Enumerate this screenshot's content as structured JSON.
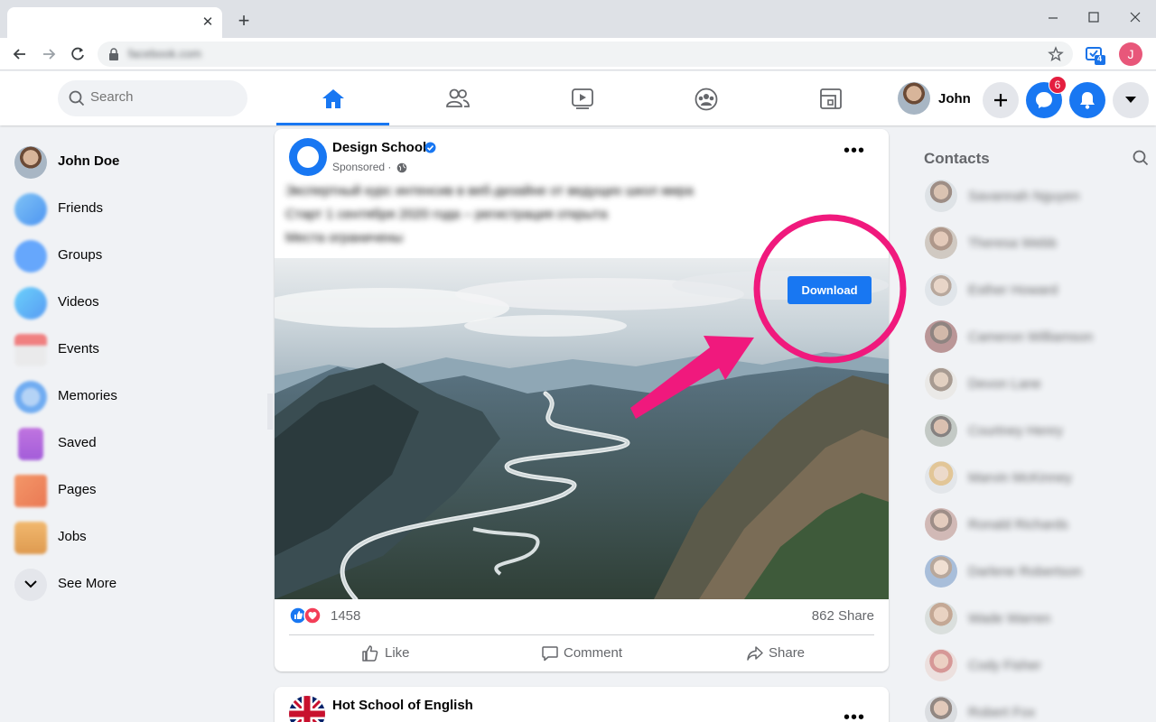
{
  "browser": {
    "close_tab_glyph": "✕",
    "new_tab_glyph": "+",
    "url": "facebook.com",
    "extension_badge": "4",
    "profile_initial": "J"
  },
  "header": {
    "search_placeholder": "Search",
    "user_name": "John",
    "messenger_badge": "6",
    "brand_color": "#1877f2"
  },
  "left_nav": {
    "items": [
      {
        "label": "John Doe",
        "icon": "avatar"
      },
      {
        "label": "Friends",
        "icon": "friends-icon"
      },
      {
        "label": "Groups",
        "icon": "groups-icon"
      },
      {
        "label": "Videos",
        "icon": "videos-icon"
      },
      {
        "label": "Events",
        "icon": "events-icon"
      },
      {
        "label": "Memories",
        "icon": "memories-icon"
      },
      {
        "label": "Saved",
        "icon": "saved-icon"
      },
      {
        "label": "Pages",
        "icon": "pages-icon"
      },
      {
        "label": "Jobs",
        "icon": "jobs-icon"
      },
      {
        "label": "See More",
        "icon": "chevron-down-icon"
      }
    ]
  },
  "post": {
    "page_name": "Design School",
    "sponsored": "Sponsored ·",
    "text_lines": [
      "Экспертный курс интенсив в веб-дизайне от ведущих школ мира",
      "Старт 1 сентября 2020 года – регистрация открыта",
      "Места ограничены"
    ],
    "download_label": "Download",
    "reactions_count": "1458",
    "shares": "862",
    "shares_label": "Share",
    "actions": {
      "like": "Like",
      "comment": "Comment",
      "share": "Share"
    }
  },
  "post2": {
    "page_name": "Hot School of English"
  },
  "contacts": {
    "title": "Contacts",
    "names": [
      "Savannah Nguyen",
      "Theresa Webb",
      "Esther Howard",
      "Cameron Williamson",
      "Devon Lane",
      "Courtney Henry",
      "Marvin McKinney",
      "Ronald Richards",
      "Darlene Robertson",
      "Wade Warren",
      "Cody Fisher",
      "Robert Fox"
    ]
  },
  "annotation": {
    "color": "#f0197d"
  }
}
